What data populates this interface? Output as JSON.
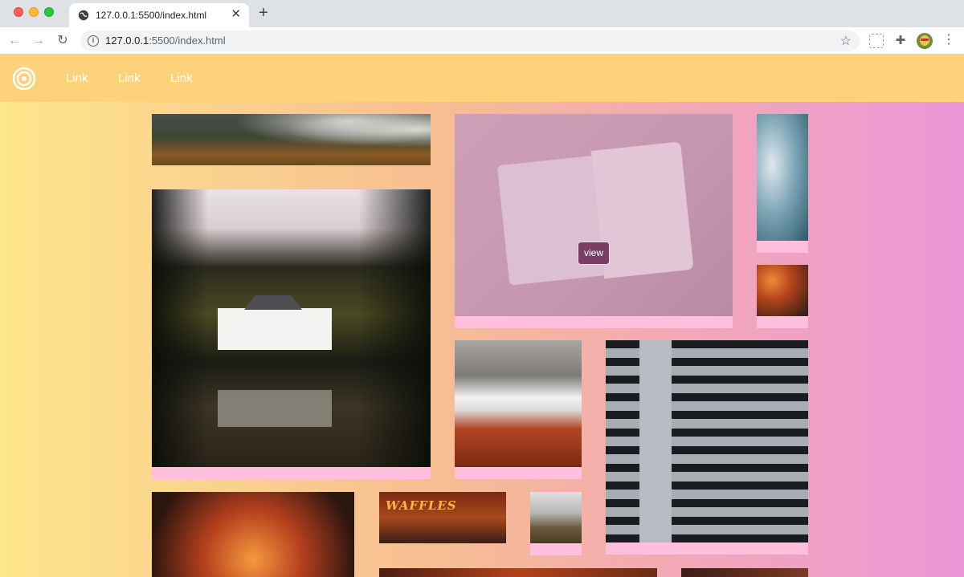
{
  "browser": {
    "tab_title": "127.0.0.1:5500/index.html",
    "tab_close": "✕",
    "new_tab": "+",
    "url_host": "127.0.0.1",
    "url_rest": ":5500/index.html",
    "icons": [
      "globe-icon",
      "back-icon",
      "forward-icon",
      "reload-icon",
      "info-icon",
      "star-icon",
      "extension-icon",
      "puzzle-icon",
      "avatar",
      "menu-icon"
    ]
  },
  "navbar": {
    "logo": "spiral-logo-icon",
    "links": [
      "Link",
      "Link",
      "Link"
    ],
    "background": "#fed27a"
  },
  "gallery": {
    "view_label": "view",
    "caption_color": "#ffbfdd",
    "photos": [
      "misty-forest",
      "open-book",
      "ocean-waves",
      "festive-lights",
      "lake-house",
      "cloud-valley",
      "office-building",
      "carousel",
      "waffles-sign",
      "foggy-hills"
    ],
    "waffles_sign": "WAFFLES"
  },
  "colors": {
    "gradient_left": "#fde68b",
    "gradient_right": "#ea97d8",
    "view_button": "#7a3e66"
  }
}
